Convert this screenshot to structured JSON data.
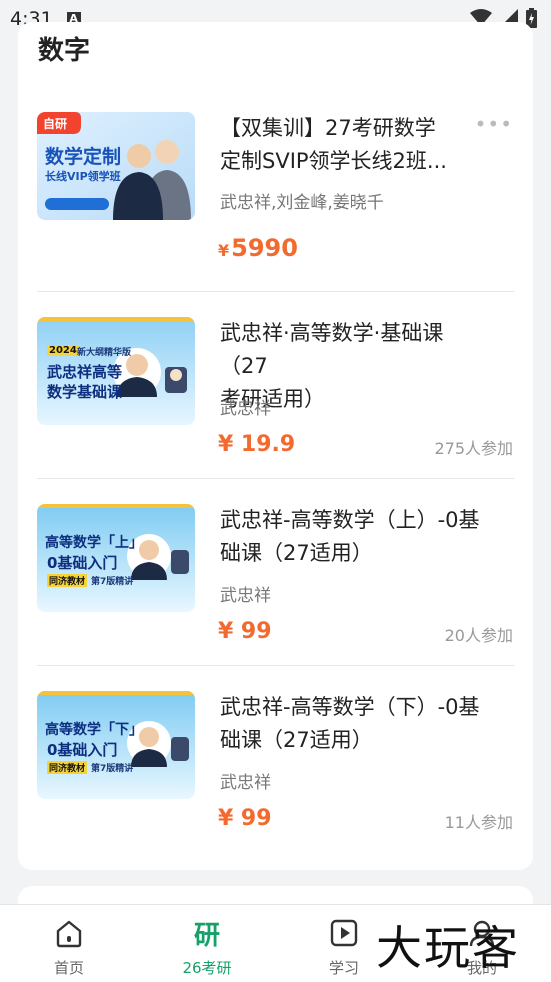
{
  "status_bar": {
    "time": "4:31",
    "notif": "A"
  },
  "section": {
    "title": "数字"
  },
  "items": [
    {
      "badge": "自研",
      "thumb_big": "数学定制",
      "thumb_sub": "长线VIP领学班",
      "title_line1": "【双集训】27考研数学",
      "title_line2": "定制SVIP领学长线2班...",
      "teacher": "武忠祥,刘金峰,姜晓千",
      "currency": "¥",
      "price": "5990",
      "join": ""
    },
    {
      "thumb_tag": "2024",
      "thumb_tag2": "新大纲精华版",
      "thumb_big": "武忠祥高等",
      "thumb_sub": "数学基础课",
      "title_line1": "武忠祥·高等数学·基础课（27",
      "title_line2": "考研适用）",
      "teacher": "武忠祥",
      "currency": "¥",
      "price": "19.9",
      "join": "275人参加"
    },
    {
      "thumb_big": "高等数学「上」",
      "thumb_sub": "0基础入门",
      "thumb_tag": "同济教材",
      "thumb_tag2": "第7版精讲",
      "title_line1": "武忠祥-高等数学（上）-0基",
      "title_line2": "础课（27适用）",
      "teacher": "武忠祥",
      "currency": "¥",
      "price": "99",
      "join": "20人参加"
    },
    {
      "thumb_big": "高等数学「下」",
      "thumb_sub": "0基础入门",
      "thumb_tag": "同济教材",
      "thumb_tag2": "第7版精讲",
      "title_line1": "武忠祥-高等数学（下）-0基",
      "title_line2": "础课（27适用）",
      "teacher": "武忠祥",
      "currency": "¥",
      "price": "99",
      "join": "11人参加"
    }
  ],
  "nav": {
    "home": "首页",
    "yan_char": "研",
    "exam": "26考研",
    "study": "学习",
    "mine": "我的"
  },
  "watermark": "大玩客",
  "colors": {
    "accent": "#16a06a",
    "price": "#f26a2e"
  }
}
